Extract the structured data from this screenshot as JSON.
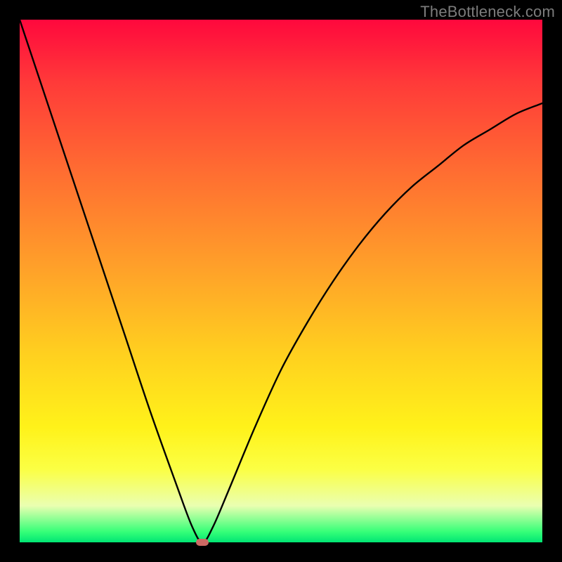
{
  "watermark": "TheBottleneck.com",
  "chart_data": {
    "type": "line",
    "title": "",
    "xlabel": "",
    "ylabel": "",
    "xlim": [
      0,
      100
    ],
    "ylim": [
      0,
      100
    ],
    "grid": false,
    "legend": false,
    "background": "red-yellow-green vertical gradient (bottleneck severity)",
    "series": [
      {
        "name": "bottleneck-curve",
        "x": [
          0,
          5,
          10,
          15,
          20,
          25,
          30,
          33,
          35,
          37,
          40,
          45,
          50,
          55,
          60,
          65,
          70,
          75,
          80,
          85,
          90,
          95,
          100
        ],
        "y": [
          100,
          85,
          70,
          55,
          40,
          25,
          11,
          3,
          0,
          3,
          10,
          22,
          33,
          42,
          50,
          57,
          63,
          68,
          72,
          76,
          79,
          82,
          84
        ]
      }
    ],
    "annotations": [
      {
        "name": "vertex-marker",
        "x": 35,
        "y": 0,
        "color": "#cc6a64",
        "shape": "rounded-rect"
      }
    ]
  }
}
